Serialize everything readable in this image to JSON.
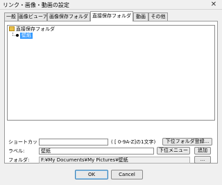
{
  "window": {
    "title": "リンク・画像・動画の設定",
    "close_glyph": "✕"
  },
  "tabs": [
    {
      "label": "一般"
    },
    {
      "label": "画像ビューア"
    },
    {
      "label": "画像保存フォルダ"
    },
    {
      "label": "直接保存フォルダ",
      "active": true
    },
    {
      "label": "動画"
    },
    {
      "label": "その他"
    }
  ],
  "tree": {
    "root_label": "直接保存フォルダ",
    "root_icon": "folder-icon",
    "child_label": "壁紙",
    "child_icon": "bullet-icon"
  },
  "form": {
    "shortcut_label": "ショートカット:",
    "shortcut_value": "",
    "shortcut_hint": "( [ 0-9A-Z]の1文字)",
    "subfolder_register_button": "下位フォルダ登録...",
    "name_label": "ラベル:",
    "name_value": "壁紙",
    "submenu_button": "下位メニュー",
    "add_button": "追加",
    "folder_label": "フォルダ:",
    "folder_value": "F:¥My Documents¥My Pictures¥壁紙",
    "browse_button": "..."
  },
  "footer": {
    "ok_button": "OK",
    "cancel_button": "Cancel"
  }
}
